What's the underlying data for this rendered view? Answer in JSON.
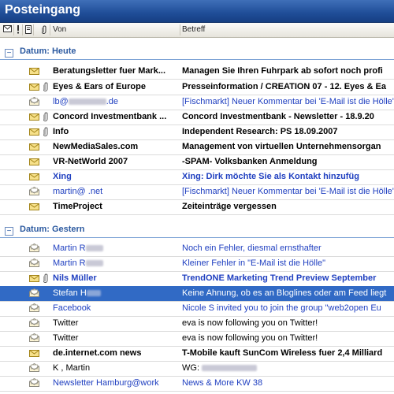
{
  "window": {
    "title": "Posteingang"
  },
  "columns": {
    "from": "Von",
    "subject": "Betreff"
  },
  "groups": [
    {
      "label": "Datum: Heute",
      "toggle": "−"
    },
    {
      "label": "Datum: Gestern",
      "toggle": "−"
    }
  ],
  "messages_today": [
    {
      "from": "Beratungsletter fuer Mark...",
      "subject": "Managen Sie Ihren Fuhrpark ab sofort noch profi",
      "icon": "closed-envelope-icon",
      "attachment": false
    },
    {
      "from": "Eyes & Ears of Europe",
      "subject": "Presseinformation / CREATION 07 - 12. Eyes & Ea",
      "icon": "closed-envelope-icon",
      "attachment": true
    },
    {
      "from": "lb@",
      "subject": "[Fischmarkt] Neuer Kommentar bei 'E-Mail ist die Hölle'",
      "icon": "open-envelope-icon",
      "attachment": false
    },
    {
      "from": "Concord Investmentbank ...",
      "subject": "Concord Investmentbank - Newsletter - 18.9.20",
      "icon": "closed-envelope-icon",
      "attachment": true
    },
    {
      "from": "Info",
      "subject": "Independent Research: PS 18.09.2007",
      "icon": "closed-envelope-icon",
      "attachment": true
    },
    {
      "from": "NewMediaSales.com",
      "subject": "Management von virtuellen Unternehmensorgan",
      "icon": "closed-envelope-icon",
      "attachment": false
    },
    {
      "from": "VR-NetWorld 2007",
      "subject": "-SPAM- Volksbanken Anmeldung",
      "icon": "closed-envelope-icon",
      "attachment": false
    },
    {
      "from": "Xing",
      "subject": "Xing: Dirk  möchte Sie als Kontakt hinzufüg",
      "icon": "closed-envelope-icon",
      "attachment": false
    },
    {
      "from": "martin@  .net",
      "subject": "[Fischmarkt] Neuer Kommentar bei 'E-Mail ist die Hölle'",
      "icon": "open-envelope-icon",
      "attachment": false
    },
    {
      "from": "TimeProject",
      "subject": "Zeiteinträge vergessen",
      "icon": "closed-envelope-icon",
      "attachment": false
    }
  ],
  "messages_yesterday": [
    {
      "from": "Martin R",
      "subject": "Noch ein Fehler, diesmal ernsthafter",
      "icon": "open-envelope-icon",
      "attachment": false
    },
    {
      "from": "Martin R",
      "subject": "Kleiner Fehler in \"E-Mail ist die Hölle\"",
      "icon": "open-envelope-icon",
      "attachment": false
    },
    {
      "from": "Nils Müller",
      "subject": "TrendONE Marketing Trend Preview September",
      "icon": "closed-envelope-icon",
      "attachment": true
    },
    {
      "from": "Stefan H",
      "subject": "Keine Ahnung, ob es an Bloglines oder am Feed liegt",
      "icon": "open-envelope-icon",
      "attachment": false
    },
    {
      "from": "Facebook",
      "subject": "Nicole S  invited you to join the group \"web2open Eu",
      "icon": "open-envelope-icon",
      "attachment": false
    },
    {
      "from": "Twitter",
      "subject": "eva is now following you on Twitter!",
      "icon": "open-envelope-icon",
      "attachment": false
    },
    {
      "from": "Twitter",
      "subject": "eva is now following you on Twitter!",
      "icon": "open-envelope-icon",
      "attachment": false
    },
    {
      "from": "de.internet.com news",
      "subject": "T-Mobile kauft SunCom Wireless fuer 2,4 Milliard",
      "icon": "closed-envelope-icon",
      "attachment": false
    },
    {
      "from": "K , Martin",
      "subject": "WG:",
      "icon": "open-envelope-icon",
      "attachment": false
    },
    {
      "from": "Newsletter Hamburg@work",
      "subject": "News & More KW 38",
      "icon": "open-envelope-icon",
      "attachment": false
    }
  ],
  "colors": {
    "accent": "#2c5aa0",
    "unread_link": "#1f3fc0",
    "selection": "#316ac5"
  }
}
